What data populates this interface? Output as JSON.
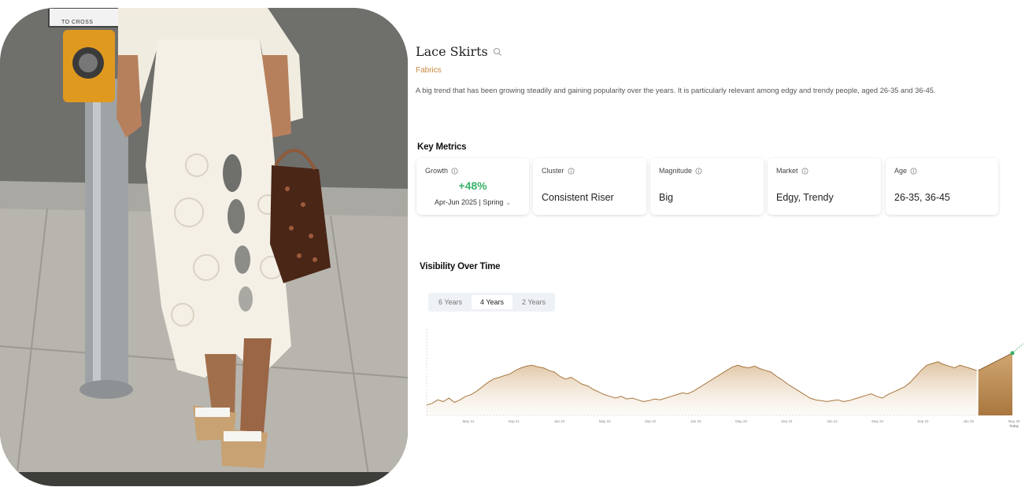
{
  "photo": {
    "sign_text": "TO CROSS"
  },
  "trend": {
    "title": "Lace Skirts",
    "category": "Fabrics",
    "description": "A big trend that has been growing steadily and gaining popularity over the years. It is particularly relevant among edgy and trendy people, aged 26-35 and 36-45."
  },
  "key_metrics": {
    "heading": "Key Metrics",
    "growth": {
      "label": "Growth",
      "value": "+48%",
      "period": "Apr-Jun 2025 | Spring"
    },
    "cluster": {
      "label": "Cluster",
      "value": "Consistent Riser"
    },
    "magnitude": {
      "label": "Magnitude",
      "value": "Big"
    },
    "market": {
      "label": "Market",
      "value": "Edgy, Trendy"
    },
    "age": {
      "label": "Age",
      "value": "26-35, 36-45"
    }
  },
  "visibility": {
    "heading": "Visibility Over Time",
    "tabs": [
      "6 Years",
      "4 Years",
      "2 Years"
    ],
    "active_tab": "4 Years",
    "today_label": "Today"
  },
  "colors": {
    "accent": "#c9893e",
    "growth": "#3ab26a",
    "line": "#a8773f"
  },
  "chart_data": {
    "type": "area",
    "x_ticks": [
      "May 21",
      "Sep 21",
      "Jan 22",
      "May 22",
      "Sep 22",
      "Jan 23",
      "May 23",
      "Sep 23",
      "Jan 24",
      "May 24",
      "Sep 24",
      "Jan 25",
      "May 25"
    ],
    "x": [
      0,
      0.5,
      1,
      1.5,
      2,
      2.5,
      3,
      3.5,
      4,
      4.5,
      5,
      5.5,
      6,
      6.5,
      7,
      7.5,
      8,
      8.5,
      9,
      9.5,
      10,
      10.5,
      11,
      11.5,
      12,
      12.5,
      13,
      13.5,
      14,
      14.5,
      15,
      15.5,
      16,
      16.5,
      17,
      17.5,
      18,
      18.5,
      19,
      19.5,
      20,
      20.5,
      21,
      21.5,
      22,
      22.5,
      23,
      23.5,
      24,
      24.5,
      25,
      25.5,
      26,
      26.5,
      27,
      27.5,
      28,
      28.5,
      29,
      29.5,
      30,
      30.5,
      31,
      31.5,
      32,
      32.5,
      33,
      33.5,
      34,
      34.5,
      35,
      35.5,
      36,
      36.5,
      37,
      37.5,
      38,
      38.5,
      39,
      39.5,
      40,
      40.5,
      41,
      41.5,
      42,
      42.5,
      43,
      43.5,
      44,
      44.5,
      45,
      45.5,
      46,
      46.5,
      47,
      47.5,
      48,
      48.5,
      49,
      49.5
    ],
    "series": [
      {
        "values": [
          12,
          14,
          18,
          16,
          20,
          15,
          18,
          22,
          24,
          28,
          33,
          38,
          42,
          44,
          46,
          48,
          52,
          55,
          57,
          58,
          56,
          55,
          52,
          50,
          45,
          42,
          44,
          40,
          36,
          34,
          30,
          27,
          24,
          22,
          20,
          22,
          19,
          20,
          18,
          16,
          17,
          19,
          18,
          20,
          22,
          24,
          26,
          25,
          28,
          32,
          36,
          40,
          44,
          48,
          52,
          56,
          58,
          56,
          55,
          57,
          54,
          52,
          50,
          45,
          41,
          36,
          32,
          28,
          24,
          20,
          18,
          17,
          16,
          17,
          18,
          16,
          17,
          19,
          21,
          23,
          25,
          22,
          20,
          24,
          27,
          30,
          33,
          38,
          45,
          52,
          58,
          60,
          62,
          59,
          57,
          55,
          58,
          56,
          54,
          52
        ]
      }
    ],
    "ylim": [
      0,
      100
    ],
    "grid": false
  }
}
